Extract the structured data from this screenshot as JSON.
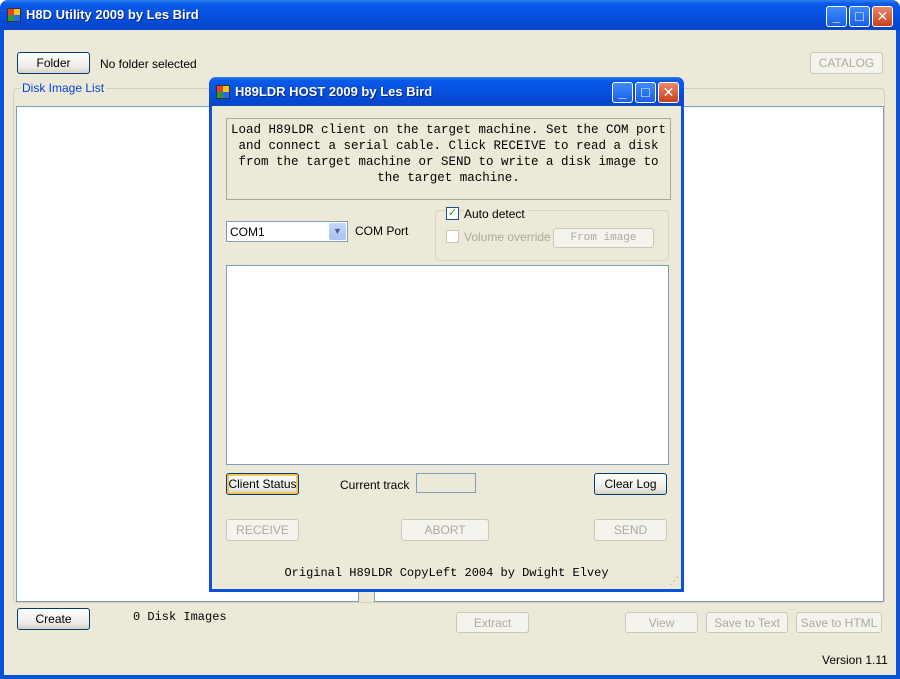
{
  "main": {
    "title": "H8D Utility 2009 by Les Bird",
    "folder_button": "Folder",
    "folder_status": "No folder selected",
    "catalog_button": "CATALOG",
    "disk_image_list_label": "Disk Image List",
    "create_button": "Create",
    "disk_image_count": "0 Disk Images",
    "extract_button": "Extract",
    "view_button": "View",
    "save_text_button": "Save to Text",
    "save_html_button": "Save to HTML",
    "version": "Version 1.11"
  },
  "dialog": {
    "title": "H89LDR HOST 2009 by Les Bird",
    "instructions": "Load H89LDR client on the target machine. Set the COM port and connect a serial cable. Click RECEIVE to read a disk from the target machine or SEND to write a disk image to the target machine.",
    "com_port_value": "COM1",
    "com_port_label": "COM Port",
    "auto_detect_label": "Auto detect",
    "auto_detect_checked": true,
    "volume_override_label": "Volume override",
    "volume_override_checked": false,
    "from_image_button": "From image",
    "client_status_button": "Client Status",
    "current_track_label": "Current track",
    "current_track_value": "",
    "clear_log_button": "Clear Log",
    "receive_button": "RECEIVE",
    "abort_button": "ABORT",
    "send_button": "SEND",
    "copyright": "Original H89LDR CopyLeft 2004 by Dwight Elvey"
  }
}
